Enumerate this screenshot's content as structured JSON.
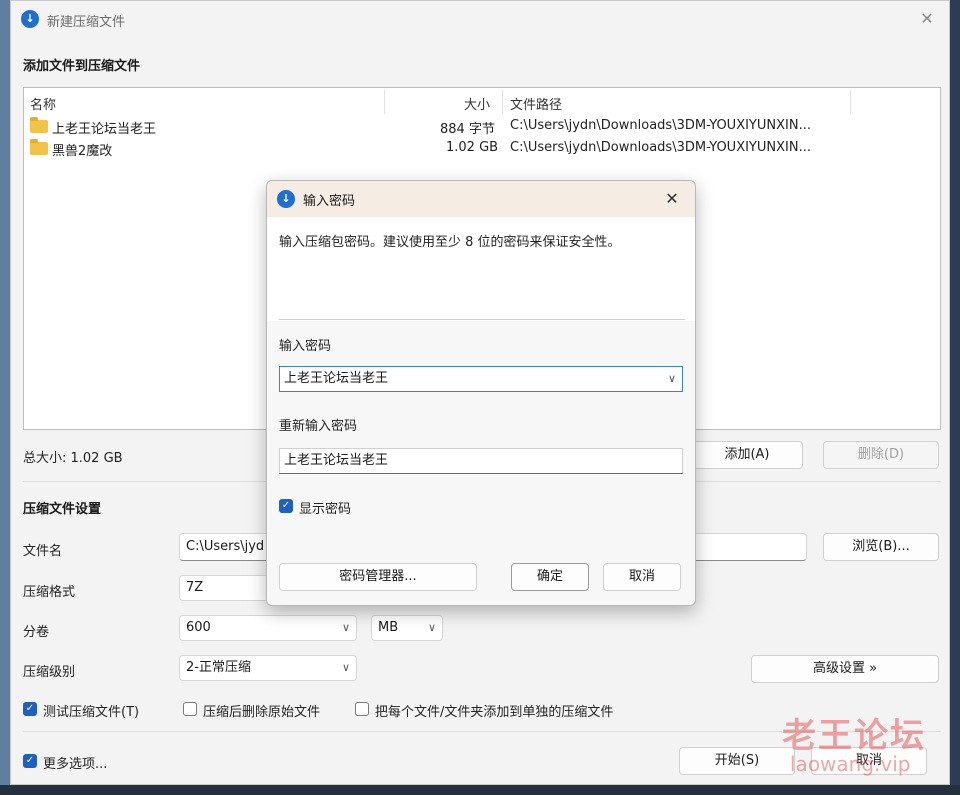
{
  "window": {
    "title": "新建压缩文件"
  },
  "add_section": {
    "title": "添加文件到压缩文件"
  },
  "file_list": {
    "columns": [
      "名称",
      "大小",
      "文件路径"
    ],
    "rows": [
      {
        "name": "上老王论坛当老王",
        "size": "884 字节",
        "path": "C:\\Users\\jydn\\Downloads\\3DM-YOUXIYUNXIN..."
      },
      {
        "name": "黑兽2魔改",
        "size": "1.02 GB",
        "path": "C:\\Users\\jydn\\Downloads\\3DM-YOUXIYUNXIN..."
      }
    ]
  },
  "total_size": "总大小: 1.02 GB",
  "buttons": {
    "add": "添加(A)",
    "delete": "删除(D)",
    "browse": "浏览(B)...",
    "advanced": "高级设置 »",
    "start": "开始(S)",
    "cancel": "取消"
  },
  "settings": {
    "title": "压缩文件设置",
    "filename_label": "文件名",
    "filename_value": "C:\\Users\\jyd",
    "format_label": "压缩格式",
    "format_value": "7Z",
    "volume_label": "分卷",
    "volume_value": "600",
    "volume_unit": "MB",
    "level_label": "压缩级别",
    "level_value": "2-正常压缩"
  },
  "checkboxes": {
    "test": {
      "label": "测试压缩文件(T)",
      "checked": true
    },
    "delete_after": {
      "label": "压缩后删除原始文件",
      "checked": false
    },
    "separate": {
      "label": "把每个文件/文件夹添加到单独的压缩文件",
      "checked": false
    },
    "more_options": {
      "label": "更多选项...",
      "checked": true
    }
  },
  "dialog": {
    "title": "输入密码",
    "description": "输入压缩包密码。建议使用至少 8 位的密码来保证安全性。",
    "password_label": "输入密码",
    "password_value": "上老王论坛当老王",
    "confirm_label": "重新输入密码",
    "confirm_value": "上老王论坛当老王",
    "show_password": {
      "label": "显示密码",
      "checked": true
    },
    "manager_button": "密码管理器...",
    "ok_button": "确定",
    "cancel_button": "取消"
  },
  "watermark": {
    "cn": "老王论坛",
    "en": "laowang.vip"
  },
  "icons": {
    "app": "app-logo-icon",
    "close": "close-icon",
    "folder": "folder-icon",
    "chevron": "chevron-down-icon",
    "check": "checkmark-icon"
  },
  "colors": {
    "accent": "#1f5fbf",
    "folder": "#f2c24b",
    "dialog_titlebar": "#f5ece4"
  }
}
